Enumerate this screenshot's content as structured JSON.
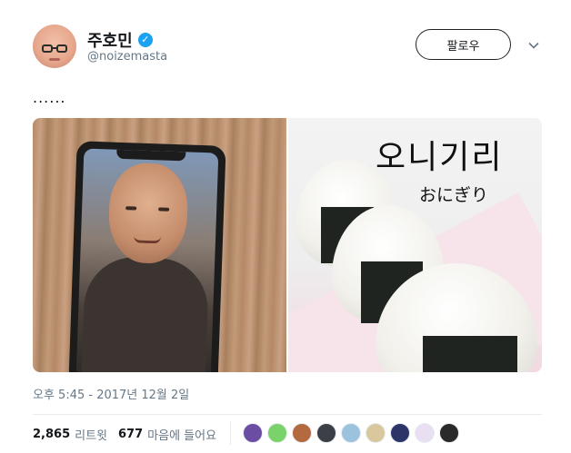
{
  "author": {
    "display_name": "주호민",
    "verified_mark": "✓",
    "handle": "@noizemasta",
    "avatar_icon": "profile-photo-avatar"
  },
  "actions": {
    "follow_label": "팔로우",
    "more_icon": "chevron-down-icon"
  },
  "tweet": {
    "text": "......"
  },
  "media": {
    "right_image_caption_ko": "오니기리",
    "right_image_caption_ja": "おにぎり"
  },
  "timestamp": "오후 5:45 - 2017년 12월 2일",
  "stats": {
    "retweets_count": "2,865",
    "retweets_label": "리트윗",
    "likes_count": "677",
    "likes_label": "마음에 들어요"
  },
  "colors": {
    "accent": "#1da1f2",
    "text_primary": "#14171a",
    "text_secondary": "#657786",
    "border": "#e6ecf0"
  },
  "likers": [
    {
      "color": "#6b4ea3"
    },
    {
      "color": "#79d36a"
    },
    {
      "color": "#b36a3e"
    },
    {
      "color": "#3d3f46"
    },
    {
      "color": "#9cc3dd"
    },
    {
      "color": "#d9c79e"
    },
    {
      "color": "#2c3468"
    },
    {
      "color": "#e8dff2"
    },
    {
      "color": "#2a2a2a"
    }
  ]
}
